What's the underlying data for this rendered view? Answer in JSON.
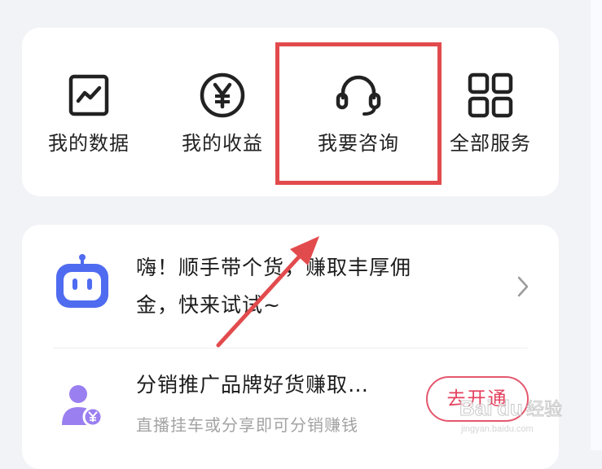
{
  "services": {
    "items": [
      {
        "label": "我的数据",
        "icon": "chart-icon"
      },
      {
        "label": "我的收益",
        "icon": "yen-coin-icon"
      },
      {
        "label": "我要咨询",
        "icon": "headset-icon"
      },
      {
        "label": "全部服务",
        "icon": "grid-icon"
      }
    ]
  },
  "promo": {
    "line1": "嗨！顺手带个货，赚取丰厚佣",
    "line2": "金，快来试试~",
    "row2_title": "分销推广品牌好货赚取…",
    "row2_subtitle": "直播挂车或分享即可分销赚钱",
    "activate_label": "去开通"
  },
  "watermark": {
    "text": "Baidu经验",
    "sub": "jingyan.baidu.com"
  },
  "colors": {
    "highlight": "#e24b4d",
    "accent": "#e4405e",
    "robot": "#4f6bf0",
    "user_icon": "#9a7ff0"
  }
}
